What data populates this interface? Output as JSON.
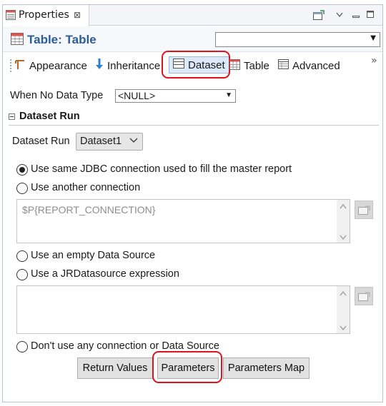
{
  "view": {
    "tab_label": "Properties",
    "close_glyph": "⊠"
  },
  "title": {
    "text": "Table: Table",
    "combo_value": ""
  },
  "section_tabs": [
    {
      "label": "Appearance",
      "icon": "appearance-icon",
      "selected": false
    },
    {
      "label": "Inheritance",
      "icon": "inheritance-icon",
      "selected": false
    },
    {
      "label": "Dataset",
      "icon": "dataset-icon",
      "selected": true
    },
    {
      "label": "Table",
      "icon": "table-icon",
      "selected": false
    },
    {
      "label": "Advanced",
      "icon": "advanced-icon",
      "selected": false
    }
  ],
  "overflow_glyph": "»",
  "no_data": {
    "label": "When No Data Type",
    "value": "<NULL>"
  },
  "dataset_run": {
    "section_title": "Dataset Run",
    "label": "Dataset Run",
    "value": "Dataset1"
  },
  "connection": {
    "options": [
      {
        "label": "Use same JDBC connection used to fill the master report",
        "checked": true
      },
      {
        "label": "Use another connection",
        "checked": false
      },
      {
        "label": "Use an empty Data Source",
        "checked": false
      },
      {
        "label": "Use a JRDatasource expression",
        "checked": false
      },
      {
        "label": "Don't use any connection or Data Source",
        "checked": false
      }
    ],
    "connection_expression": "$P{REPORT_CONNECTION}",
    "datasource_expression": ""
  },
  "buttons": {
    "return_values": "Return Values",
    "parameters": "Parameters",
    "parameters_map": "Parameters Map"
  },
  "colors": {
    "title": "#2b5d99",
    "highlight": "#e0121b",
    "selected_tab_bg": "#dce9f8"
  }
}
